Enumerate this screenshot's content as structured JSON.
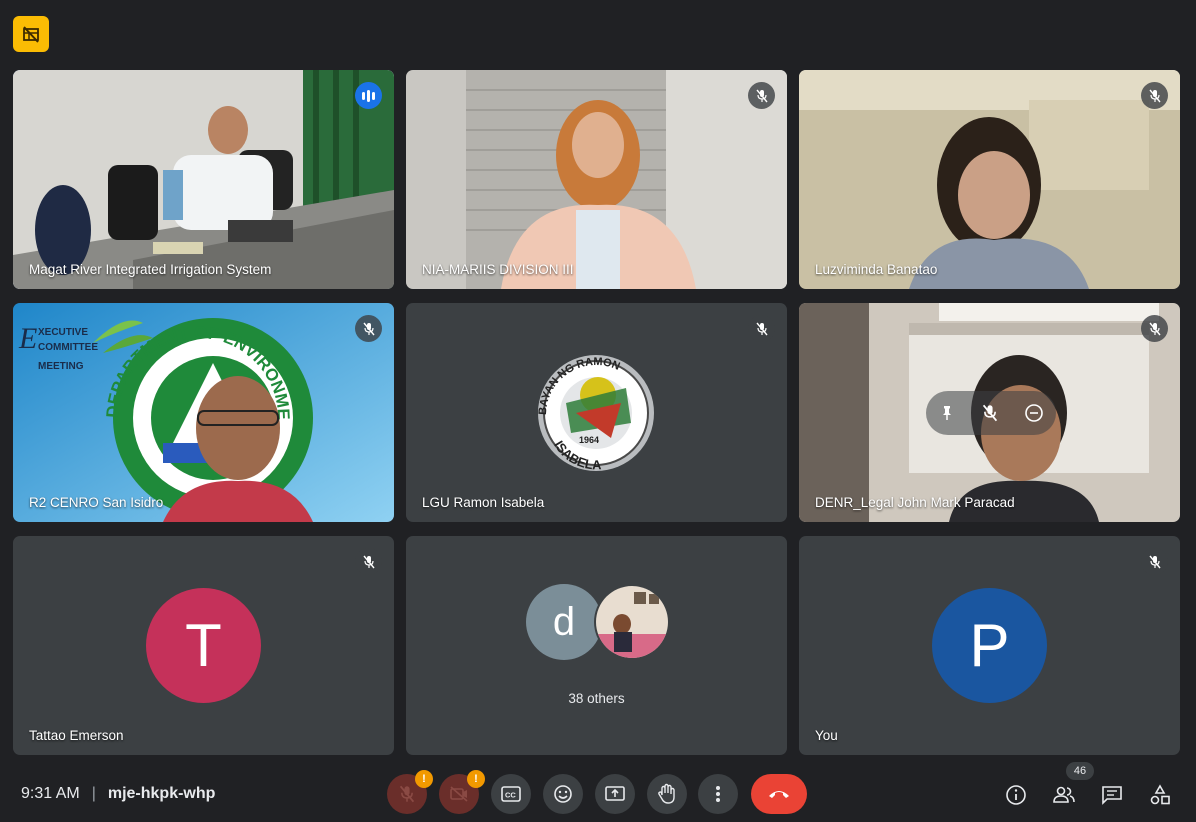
{
  "meeting": {
    "time": "9:31 AM",
    "separator": "|",
    "code": "mje-hkpk-whp",
    "participant_count": "46"
  },
  "tiles": [
    {
      "name": "Magat River Integrated Irrigation System",
      "state": "speaking"
    },
    {
      "name": "NIA-MARIIS DIVISION III",
      "state": "muted"
    },
    {
      "name": "Luzviminda Banatao",
      "state": "muted"
    },
    {
      "name": "R2 CENRO San Isidro",
      "state": "muted"
    },
    {
      "name": "LGU Ramon Isabela",
      "state": "muted"
    },
    {
      "name": "DENR_Legal John Mark Paracad",
      "state": "muted"
    },
    {
      "name": "Tattao Emerson",
      "avatar_letter": "T",
      "avatar_color": "#c5315a",
      "state": "muted"
    },
    {
      "name": "38 others",
      "avatar_letter": "d",
      "avatar_color": "#7b8e98"
    },
    {
      "name": "You",
      "avatar_letter": "P",
      "avatar_color": "#1a56a0",
      "state": "muted"
    }
  ],
  "tile_overlay_text": {
    "executive": "XECUTIVE",
    "committee": "COMMITTEE",
    "meeting": "MEETING",
    "denr_seal": "DEPARTMENT OF ENVIRONMENT AND NATURAL",
    "lgu_seal_top": "BAYAN NG RAMON",
    "lgu_seal_year": "1964",
    "lgu_seal_bottom": "ISABELA"
  },
  "controls": {
    "mic_alert": "!",
    "cam_alert": "!"
  },
  "icons": [
    "tile-layout-off-icon",
    "mic-off-icon",
    "speaking-indicator-icon",
    "pin-icon",
    "remove-icon",
    "camera-off-icon",
    "captions-icon",
    "emoji-icon",
    "present-icon",
    "raise-hand-icon",
    "more-icon",
    "end-call-icon",
    "info-icon",
    "people-icon",
    "chat-icon",
    "activities-icon"
  ],
  "colors": {
    "accent": "#8ab4f8",
    "end_call": "#ea4335",
    "alert": "#f29900",
    "background": "#202124"
  }
}
